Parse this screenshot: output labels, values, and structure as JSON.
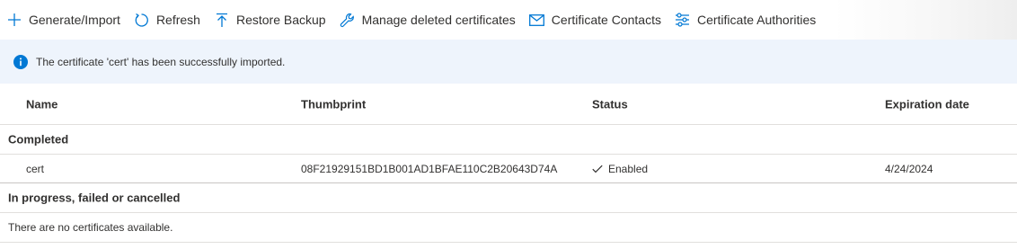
{
  "toolbar": {
    "buttons": [
      {
        "label": "Generate/Import",
        "icon": "plus-icon"
      },
      {
        "label": "Refresh",
        "icon": "refresh-icon"
      },
      {
        "label": "Restore Backup",
        "icon": "upload-arrow-icon"
      },
      {
        "label": "Manage deleted certificates",
        "icon": "wrench-icon"
      },
      {
        "label": "Certificate Contacts",
        "icon": "envelope-icon"
      },
      {
        "label": "Certificate Authorities",
        "icon": "sliders-icon"
      }
    ]
  },
  "banner": {
    "icon": "info-icon",
    "message": "The certificate 'cert' has been successfully imported."
  },
  "table": {
    "columns": [
      "Name",
      "Thumbprint",
      "Status",
      "Expiration date"
    ],
    "groups": [
      {
        "label": "Completed",
        "rows": [
          {
            "name": "cert",
            "thumbprint": "08F21929151BD1B001AD1BFAE110C2B20643D74A",
            "status": "Enabled",
            "expiration": "4/24/2024"
          }
        ]
      },
      {
        "label": "In progress, failed or cancelled",
        "empty_text": "There are no certificates available."
      }
    ]
  },
  "colors": {
    "accent": "#0078d4",
    "banner_bg": "#eef4fc",
    "text": "#323130"
  }
}
